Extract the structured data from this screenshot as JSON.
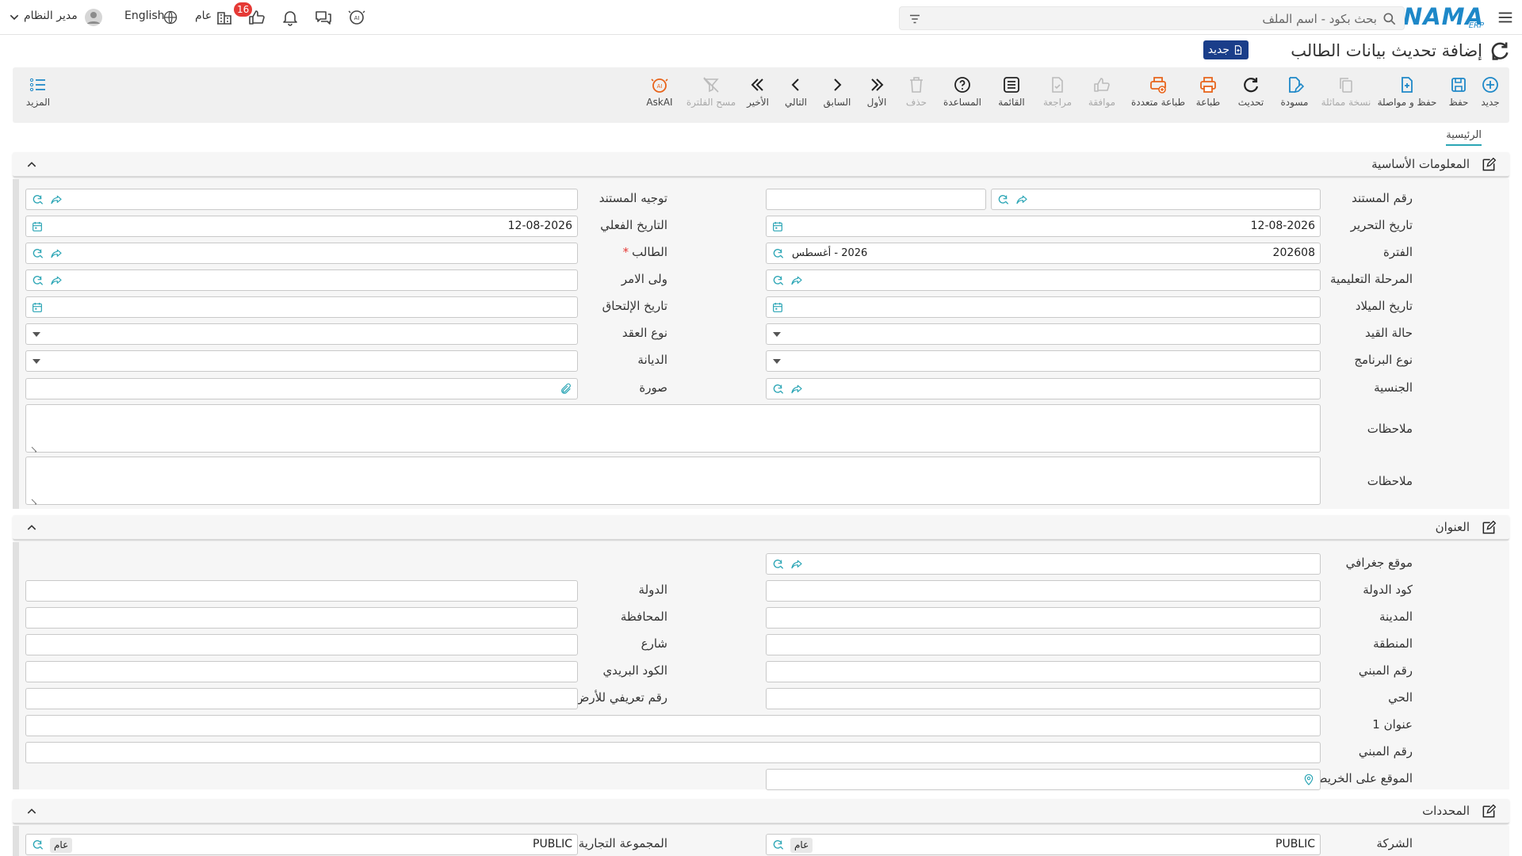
{
  "topbar": {
    "logo_main": "NAMA",
    "logo_sub": "ERP",
    "search_placeholder": "بحث بكود - اسم الملف",
    "language": "English",
    "user_name": "مدير النظام",
    "scope": "عام",
    "notification_count": "16"
  },
  "title_bar": {
    "title": "إضافة تحديث بيانات الطالب",
    "status_badge": "جديد"
  },
  "toolbar": {
    "new": "جديد",
    "save": "حفظ",
    "save_continue": "حفظ و مواصلة",
    "duplicate": "نسخة مماثلة",
    "draft": "مسودة",
    "refresh": "تحديث",
    "print": "طباعة",
    "multi_print": "طباعة متعددة",
    "approve": "موافقة",
    "review": "مراجعة",
    "list": "القائمة",
    "help": "المساعدة",
    "delete": "حذف",
    "first": "الأول",
    "previous": "السابق",
    "next": "التالي",
    "last": "الأخير",
    "clear_filter": "مسح الفلترة",
    "ask_ai": "AskAI",
    "more": "المزيد"
  },
  "tabs": {
    "main": "الرئيسية"
  },
  "basic_info": {
    "title": "المعلومات الأساسية",
    "doc_number_label": "رقم المستند",
    "doc_direction_label": "توجيه المستند",
    "edit_date_label": "تاريخ التحرير",
    "edit_date_value": "12-08-2026",
    "actual_date_label": "التاريخ الفعلي",
    "actual_date_value": "12-08-2026",
    "period_label": "الفترة",
    "period_value": "202608",
    "period_name": "2026 - أغسطس",
    "student_label": "الطالب",
    "required_mark": "*",
    "stage_label": "المرحلة التعليمية",
    "guardian_label": "ولى الامر",
    "birth_date_label": "تاريخ الميلاد",
    "join_date_label": "تاريخ الإلتحاق",
    "enroll_status_label": "حالة القيد",
    "contract_type_label": "نوع العقد",
    "program_type_label": "نوع البرنامج",
    "religion_label": "الديانة",
    "nationality_label": "الجنسية",
    "photo_label": "صورة",
    "notes1_label": "ملاحظات",
    "notes2_label": "ملاحظات"
  },
  "address": {
    "title": "العنوان",
    "geo_location_label": "موقع جغرافي",
    "country_code_label": "كود الدولة",
    "country_label": "الدولة",
    "city_label": "المدينة",
    "governorate_label": "المحافظة",
    "region_label": "المنطقة",
    "street_label": "شارع",
    "building_no_label": "رقم المبني",
    "postal_code_label": "الكود البريدي",
    "district_label": "الحي",
    "land_id_label": "رقم تعريفي للأرض",
    "address1_label": "عنوان 1",
    "building_no2_label": "رقم المبني",
    "map_location_label": "الموقع على الخريطة"
  },
  "determinants": {
    "title": "المحددات",
    "company_label": "الشركة",
    "company_value": "PUBLIC",
    "company_chip": "عام",
    "group_label": "المجموعة التجارية",
    "group_value": "PUBLIC",
    "group_chip": "عام"
  },
  "colors": {
    "brand": "#1e88c8",
    "accent_teal": "#2aa5b5",
    "badge_navy": "#1a3e8a",
    "print_orange": "#e8641b",
    "danger": "#e53935"
  }
}
